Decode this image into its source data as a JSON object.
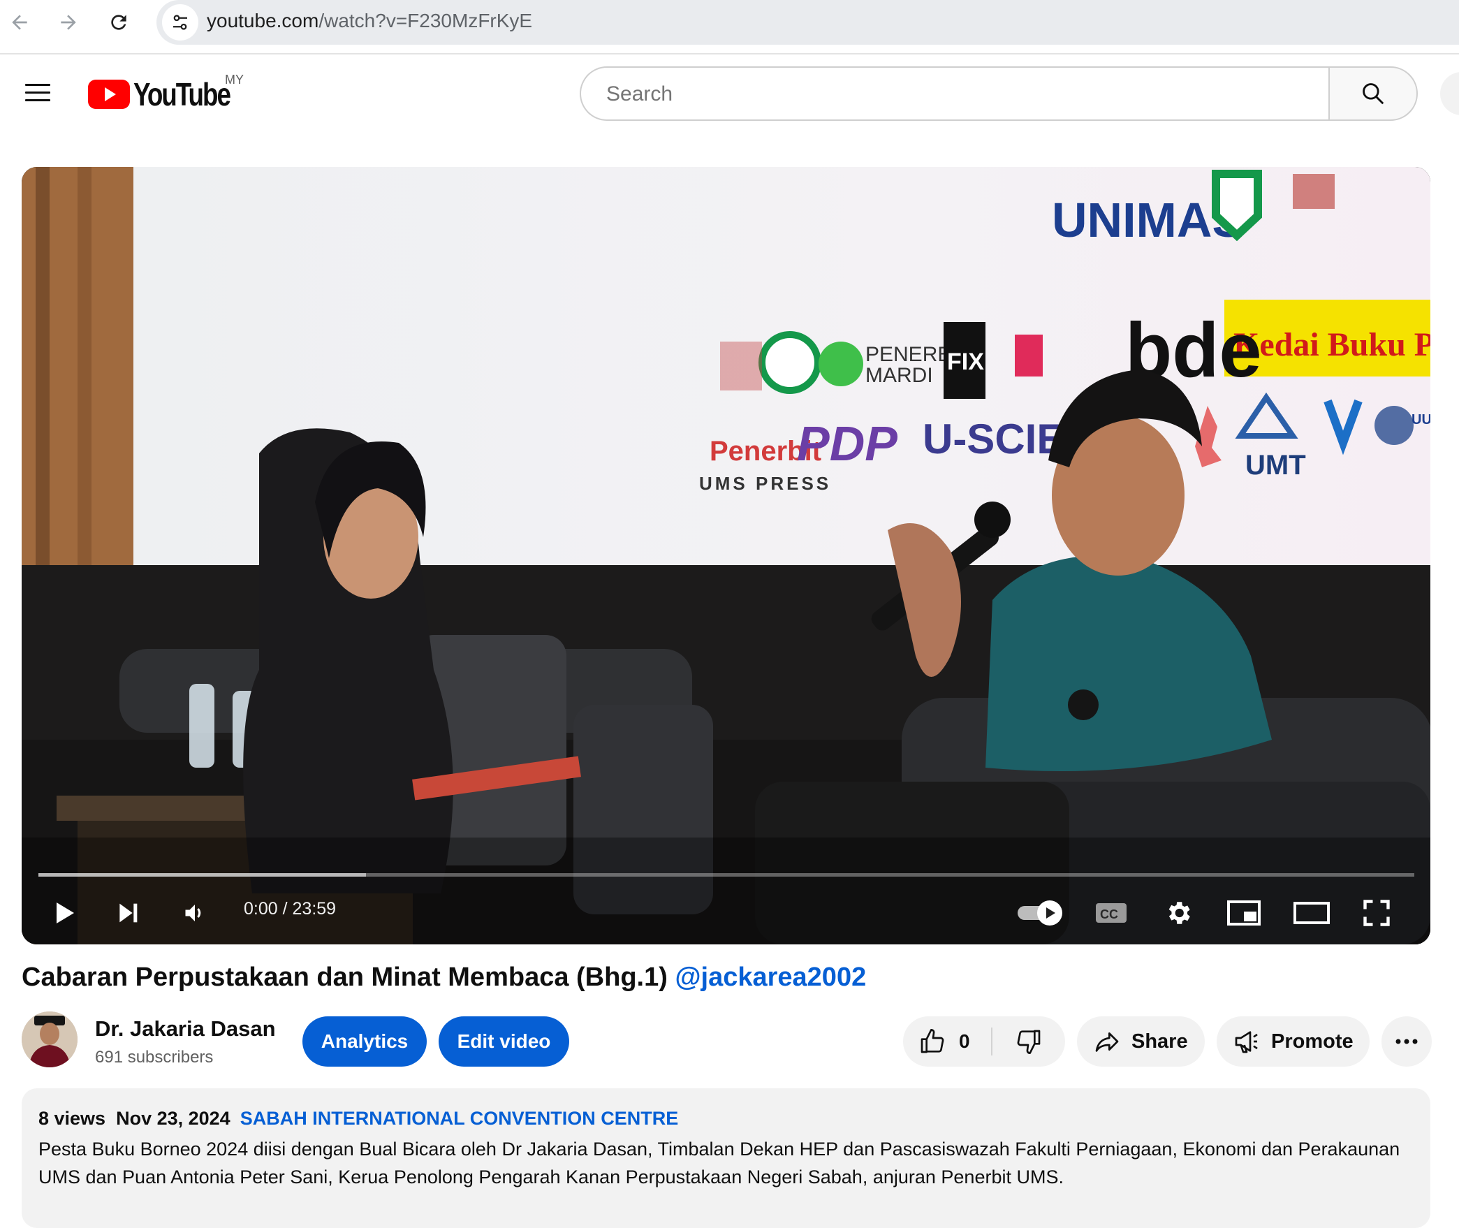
{
  "browser": {
    "url_domain": "youtube.com",
    "url_path": "/watch?v=F230MzFrKyE"
  },
  "header": {
    "logo_text": "YouTube",
    "region": "MY",
    "search_placeholder": "Search"
  },
  "player": {
    "time_current": "0:00",
    "time_separator": " / ",
    "time_total": "23:59",
    "buffered_fraction": 0.238,
    "autoplay": "on",
    "backdrop_signs": {
      "unimas": "UNIMAS",
      "penerbit_mardi": "PENERBIT\nMARDI",
      "fix": "FIX",
      "kedai_buku": "Kedai Buku Putatan",
      "penerbit": "Penerbit",
      "ums_press": "UMS PRESS",
      "pdp": "PDP",
      "u_scie": "U-SCIE",
      "umt": "UMT",
      "bde": "bde",
      "uum": "UUM"
    }
  },
  "video": {
    "title": "Cabaran Perpustakaan dan Minat Membaca (Bhg.1)",
    "handle": "@jackarea2002"
  },
  "channel": {
    "name": "Dr. Jakaria Dasan",
    "subscribers": "691 subscribers"
  },
  "actions": {
    "analytics": "Analytics",
    "edit_video": "Edit video",
    "like_count": "0",
    "share": "Share",
    "promote": "Promote"
  },
  "description": {
    "views": "8 views",
    "date": "Nov 23, 2024",
    "location": "SABAH INTERNATIONAL CONVENTION CENTRE",
    "text": "Pesta Buku Borneo 2024 diisi dengan Bual Bicara oleh Dr Jakaria Dasan, Timbalan Dekan HEP dan Pascasiswazah Fakulti Perniagaan, Ekonomi dan Perakaunan UMS dan Puan Antonia Peter Sani, Kerua Penolong Pengarah Kanan Perpustakaan Negeri Sabah, anjuran Penerbit UMS."
  },
  "colors": {
    "youtube_red": "#ff0000",
    "link_blue": "#065fd4",
    "pill_gray": "#f2f2f2"
  }
}
